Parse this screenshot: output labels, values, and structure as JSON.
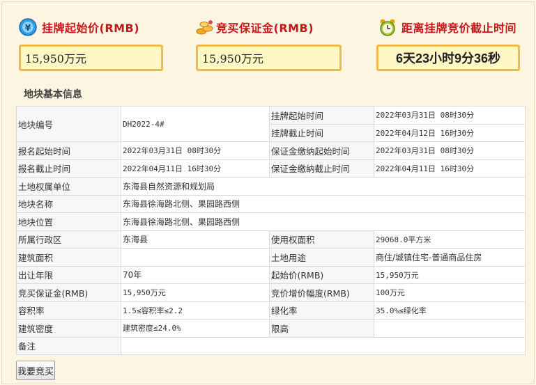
{
  "stats": [
    {
      "title": "挂牌起始价(RMB)",
      "value": "15,950万元",
      "icon": "money-icon"
    },
    {
      "title": "竞买保证金(RMB)",
      "value": "15,950万元",
      "icon": "coins-icon"
    },
    {
      "title": "距离挂牌竞价截止时间",
      "value": "6天23小时9分36秒",
      "icon": "alarm-clock-icon"
    }
  ],
  "section_title": "地块基本信息",
  "table": {
    "r0": {
      "l1": "地块编号",
      "v1": "DH2022-4#",
      "l2": "挂牌起始时间",
      "v2": "2022年03月31日 08时30分"
    },
    "r1": {
      "l2": "挂牌截止时间",
      "v2": "2022年04月12日 16时30分"
    },
    "r2": {
      "l1": "报名起始时间",
      "v1": "2022年03月31日 08时30分",
      "l2": "保证金缴纳起始时间",
      "v2": "2022年03月31日 08时30分"
    },
    "r3": {
      "l1": "报名截止时间",
      "v1": "2022年04月11日 16时30分",
      "l2": "保证金缴纳截止时间",
      "v2": "2022年04月11日 16时30分"
    },
    "r4": {
      "l1": "土地权属单位",
      "v1": "东海县自然资源和规划局"
    },
    "r5": {
      "l1": "地块名称",
      "v1": "东海县徐海路北侧、果园路西侧"
    },
    "r6": {
      "l1": "地块位置",
      "v1": "东海县徐海路北侧、果园路西侧"
    },
    "r7": {
      "l1": "所属行政区",
      "v1": "东海县",
      "l2": "使用权面积",
      "v2": "29068.0平方米"
    },
    "r8": {
      "l1": "建筑面积",
      "v1": "",
      "l2": "土地用途",
      "v2": "商住/城镇住宅-普通商品住房"
    },
    "r9": {
      "l1": "出让年限",
      "v1": "70年",
      "l2": "起始价(RMB)",
      "v2": "15,950万元"
    },
    "r10": {
      "l1": "竞买保证金(RMB)",
      "v1": "15,950万元",
      "l2": "竞价增价幅度(RMB)",
      "v2": "100万元"
    },
    "r11": {
      "l1": "容积率",
      "v1": "1.5≤容积率≤2.2",
      "l2": "绿化率",
      "v2": "35.0%≤绿化率"
    },
    "r12": {
      "l1": "建筑密度",
      "v1": "建筑密度≤24.0%",
      "l2": "限高",
      "v2": ""
    },
    "r13": {
      "l1": "备注",
      "v1": ""
    }
  },
  "buy_button": "我要竞买",
  "colors": {
    "accent_red": "#c8161d",
    "box_border": "#f2b84a",
    "box_fill": "#fff8c6",
    "page_bg": "#fbf5e1"
  }
}
